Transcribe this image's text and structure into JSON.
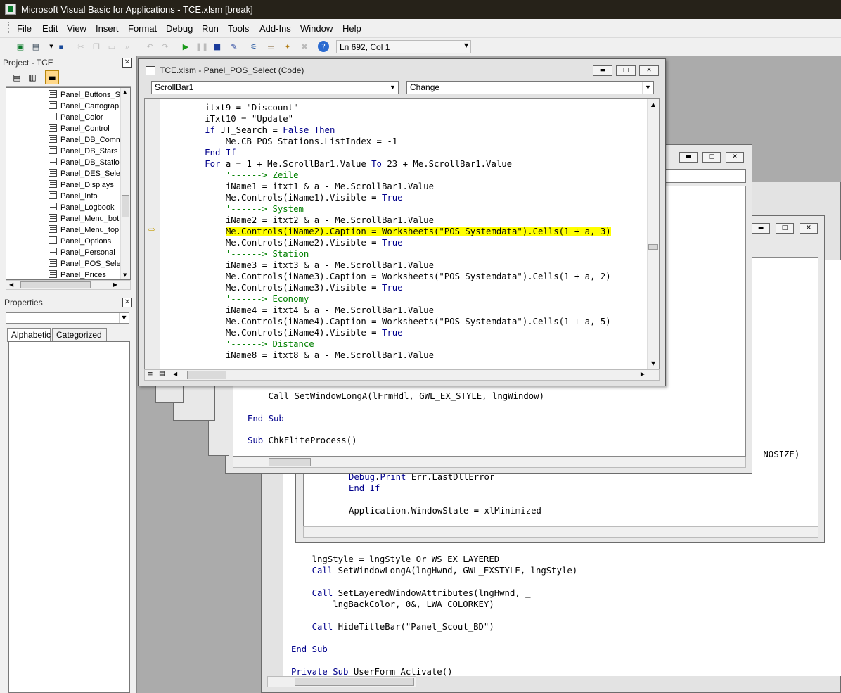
{
  "app": {
    "title": "Microsoft Visual Basic for Applications - TCE.xlsm [break]"
  },
  "menu": [
    "File",
    "Edit",
    "View",
    "Insert",
    "Format",
    "Debug",
    "Run",
    "Tools",
    "Add-Ins",
    "Window",
    "Help"
  ],
  "toolbar": {
    "position": "Ln 692, Col 1"
  },
  "project": {
    "title": "Project - TCE",
    "items": [
      "Panel_Buttons_S",
      "Panel_Cartograp",
      "Panel_Color",
      "Panel_Control",
      "Panel_DB_Comm",
      "Panel_DB_Stars",
      "Panel_DB_Station",
      "Panel_DES_Selec",
      "Panel_Displays",
      "Panel_Info",
      "Panel_Logbook",
      "Panel_Menu_bot",
      "Panel_Menu_top",
      "Panel_Options",
      "Panel_Personal",
      "Panel_POS_Selec",
      "Panel_Prices"
    ]
  },
  "properties": {
    "title": "Properties",
    "tabs": [
      "Alphabetic",
      "Categorized"
    ]
  },
  "codewin": {
    "title": "TCE.xlsm - Panel_POS_Select (Code)",
    "object": "ScrollBar1",
    "procedure": "Change",
    "lines": [
      "        itxt9 = \"Discount\"",
      "        iTxt10 = \"Update\"",
      "        If JT_Search = False Then",
      "            Me.CB_POS_Stations.ListIndex = -1",
      "        End If",
      "        For a = 1 + Me.ScrollBar1.Value To 23 + Me.ScrollBar1.Value",
      "            '------> Zeile",
      "            iName1 = itxt1 & a - Me.ScrollBar1.Value",
      "            Me.Controls(iName1).Visible = True",
      "            '------> System",
      "            iName2 = itxt2 & a - Me.ScrollBar1.Value",
      "            Me.Controls(iName2).Caption = Worksheets(\"POS_Systemdata\").Cells(1 + a, 3)",
      "            Me.Controls(iName2).Visible = True",
      "            '------> Station",
      "            iName3 = itxt3 & a - Me.ScrollBar1.Value",
      "            Me.Controls(iName3).Caption = Worksheets(\"POS_Systemdata\").Cells(1 + a, 2)",
      "            Me.Controls(iName3).Visible = True",
      "            '------> Economy",
      "            iName4 = itxt4 & a - Me.ScrollBar1.Value",
      "            Me.Controls(iName4).Caption = Worksheets(\"POS_Systemdata\").Cells(1 + a, 5)",
      "            Me.Controls(iName4).Visible = True",
      "            '------> Distance",
      "            iName8 = itxt8 & a - Me.ScrollBar1.Value"
    ],
    "highlight_index": 11
  },
  "bg": {
    "w3_lines": [
      "    Call SetWindowLongA(lFrmHdl, GWL_EX_STYLE, lngWindow)",
      "",
      "End Sub",
      "",
      "Sub ChkEliteProcess()"
    ],
    "w4_lines": [
      "_NOSIZE)"
    ],
    "w5_lines": [
      "        Debug.Print Err.LastDllError",
      "        End If",
      "",
      "        Application.WindowState = xlMinimized"
    ],
    "w6_lines": [
      "    lngStyle = lngStyle Or WS_EX_LAYERED",
      "    Call SetWindowLongA(lngHwnd, GWL_EXSTYLE, lngStyle)",
      "",
      "    Call SetLayeredWindowAttributes(lngHwnd, _",
      "        lngBackColor, 0&, LWA_COLORKEY)",
      "",
      "    Call HideTitleBar(\"Panel_Scout_BD\")",
      "",
      "End Sub",
      "",
      "Private Sub UserForm_Activate()"
    ]
  }
}
